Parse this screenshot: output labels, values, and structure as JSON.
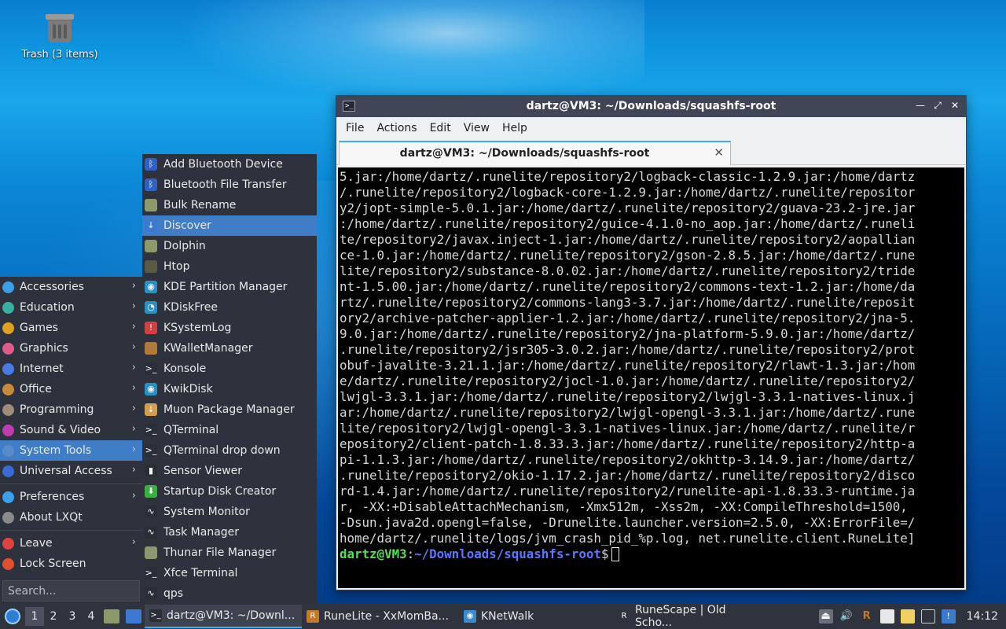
{
  "desktop": {
    "trash_label": "Trash (3 items)"
  },
  "terminal": {
    "window_title": "dartz@VM3: ~/Downloads/squashfs-root",
    "menu": [
      "File",
      "Actions",
      "Edit",
      "View",
      "Help"
    ],
    "tab_title": "dartz@VM3: ~/Downloads/squashfs-root",
    "lines": [
      "5.jar:/home/dartz/.runelite/repository2/logback-classic-1.2.9.jar:/home/dartz",
      "/.runelite/repository2/logback-core-1.2.9.jar:/home/dartz/.runelite/repositor",
      "y2/jopt-simple-5.0.1.jar:/home/dartz/.runelite/repository2/guava-23.2-jre.jar",
      ":/home/dartz/.runelite/repository2/guice-4.1.0-no_aop.jar:/home/dartz/.runeli",
      "te/repository2/javax.inject-1.jar:/home/dartz/.runelite/repository2/aopallian",
      "ce-1.0.jar:/home/dartz/.runelite/repository2/gson-2.8.5.jar:/home/dartz/.rune",
      "lite/repository2/substance-8.0.02.jar:/home/dartz/.runelite/repository2/tride",
      "nt-1.5.00.jar:/home/dartz/.runelite/repository2/commons-text-1.2.jar:/home/da",
      "rtz/.runelite/repository2/commons-lang3-3.7.jar:/home/dartz/.runelite/reposit",
      "ory2/archive-patcher-applier-1.2.jar:/home/dartz/.runelite/repository2/jna-5.",
      "9.0.jar:/home/dartz/.runelite/repository2/jna-platform-5.9.0.jar:/home/dartz/",
      ".runelite/repository2/jsr305-3.0.2.jar:/home/dartz/.runelite/repository2/prot",
      "obuf-javalite-3.21.1.jar:/home/dartz/.runelite/repository2/rlawt-1.3.jar:/hom",
      "e/dartz/.runelite/repository2/jocl-1.0.jar:/home/dartz/.runelite/repository2/",
      "lwjgl-3.3.1.jar:/home/dartz/.runelite/repository2/lwjgl-3.3.1-natives-linux.j",
      "ar:/home/dartz/.runelite/repository2/lwjgl-opengl-3.3.1.jar:/home/dartz/.rune",
      "lite/repository2/lwjgl-opengl-3.3.1-natives-linux.jar:/home/dartz/.runelite/r",
      "epository2/client-patch-1.8.33.3.jar:/home/dartz/.runelite/repository2/http-a",
      "pi-1.1.3.jar:/home/dartz/.runelite/repository2/okhttp-3.14.9.jar:/home/dartz/",
      ".runelite/repository2/okio-1.17.2.jar:/home/dartz/.runelite/repository2/disco",
      "rd-1.4.jar:/home/dartz/.runelite/repository2/runelite-api-1.8.33.3-runtime.ja",
      "r, -XX:+DisableAttachMechanism, -Xmx512m, -Xss2m, -XX:CompileThreshold=1500,",
      "-Dsun.java2d.opengl=false, -Drunelite.launcher.version=2.5.0, -XX:ErrorFile=/",
      "home/dartz/.runelite/logs/jvm_crash_pid_%p.log, net.runelite.client.RuneLite]"
    ],
    "prompt_user": "dartz@VM3",
    "prompt_sep": ":",
    "prompt_path": "~/Downloads/squashfs-root",
    "prompt_end": "$"
  },
  "start_menu": {
    "categories": [
      {
        "label": "Accessories",
        "icon_color": "#3aa0e8"
      },
      {
        "label": "Education",
        "icon_color": "#38b0a0"
      },
      {
        "label": "Games",
        "icon_color": "#e0a020"
      },
      {
        "label": "Graphics",
        "icon_color": "#e05a8a"
      },
      {
        "label": "Internet",
        "icon_color": "#4a7ae8"
      },
      {
        "label": "Office",
        "icon_color": "#c88a3a"
      },
      {
        "label": "Programming",
        "icon_color": "#a08a7a"
      },
      {
        "label": "Sound & Video",
        "icon_color": "#c03ab0"
      },
      {
        "label": "System Tools",
        "icon_color": "#5a8ac8"
      },
      {
        "label": "Universal Access",
        "icon_color": "#3a6ad8"
      }
    ],
    "extras": [
      {
        "label": "Preferences",
        "icon_color": "#3aa0e8"
      },
      {
        "label": "About LXQt",
        "icon_color": "#8a8a8a"
      }
    ],
    "session": [
      {
        "label": "Leave",
        "icon_color": "#e04040"
      },
      {
        "label": "Lock Screen",
        "icon_color": "#e05030"
      }
    ],
    "search_placeholder": "Search..."
  },
  "system_tools": [
    {
      "label": "Add Bluetooth Device",
      "icon": "bluetooth-icon",
      "color": "#3060c0",
      "glyph": "ᛒ"
    },
    {
      "label": "Bluetooth File Transfer",
      "icon": "bluetooth-icon",
      "color": "#3060c0",
      "glyph": "ᛒ"
    },
    {
      "label": "Bulk Rename",
      "icon": "folder-rename-icon",
      "color": "#8a9a6a",
      "glyph": ""
    },
    {
      "label": "Discover",
      "icon": "download-icon",
      "color": "#3a7ad0",
      "glyph": "↓"
    },
    {
      "label": "Dolphin",
      "icon": "folder-icon",
      "color": "#8a9a6a",
      "glyph": ""
    },
    {
      "label": "Htop",
      "icon": "htop-icon",
      "color": "#5a5a48",
      "glyph": ""
    },
    {
      "label": "KDE Partition Manager",
      "icon": "disk-icon",
      "color": "#2a90c0",
      "glyph": "◉"
    },
    {
      "label": "KDiskFree",
      "icon": "disk-free-icon",
      "color": "#2a90c0",
      "glyph": "◔"
    },
    {
      "label": "KSystemLog",
      "icon": "log-icon",
      "color": "#d04040",
      "glyph": "!"
    },
    {
      "label": "KWalletManager",
      "icon": "wallet-icon",
      "color": "#b07a3a",
      "glyph": ""
    },
    {
      "label": "Konsole",
      "icon": "terminal-icon",
      "color": "#2a2e36",
      "glyph": ">_"
    },
    {
      "label": "KwikDisk",
      "icon": "kwikdisk-icon",
      "color": "#2a90c0",
      "glyph": "◉"
    },
    {
      "label": "Muon Package Manager",
      "icon": "package-icon",
      "color": "#d0a050",
      "glyph": "↓"
    },
    {
      "label": "QTerminal",
      "icon": "terminal-icon",
      "color": "#2a2e36",
      "glyph": ">_"
    },
    {
      "label": "QTerminal drop down",
      "icon": "terminal-icon",
      "color": "#2a2e36",
      "glyph": ">_"
    },
    {
      "label": "Sensor Viewer",
      "icon": "sensor-icon",
      "color": "#2a2e36",
      "glyph": "▮"
    },
    {
      "label": "Startup Disk Creator",
      "icon": "usb-icon",
      "color": "#3ab040",
      "glyph": "⬇"
    },
    {
      "label": "System Monitor",
      "icon": "monitor-icon",
      "color": "#2a2e36",
      "glyph": "∿"
    },
    {
      "label": "Task Manager",
      "icon": "task-manager-icon",
      "color": "#2a2e36",
      "glyph": "∿"
    },
    {
      "label": "Thunar File Manager",
      "icon": "folder-icon",
      "color": "#8a9a6a",
      "glyph": ""
    },
    {
      "label": "Xfce Terminal",
      "icon": "terminal-icon",
      "color": "#2a2e36",
      "glyph": ">_"
    },
    {
      "label": "qps",
      "icon": "qps-icon",
      "color": "#2a2e36",
      "glyph": "∿"
    }
  ],
  "taskbar": {
    "desktops": [
      "1",
      "2",
      "3",
      "4"
    ],
    "tasks": [
      {
        "label": "dartz@VM3: ~/Downl...",
        "icon": "terminal-icon",
        "color": "#2a2e36",
        "glyph": ">_"
      },
      {
        "label": "RuneLite - XxMomBa...",
        "icon": "runelite-icon",
        "color": "#c07a2a",
        "glyph": "R"
      },
      {
        "label": "KNetWalk",
        "icon": "knetwalk-icon",
        "color": "#3a8ad0",
        "glyph": "◉"
      },
      {
        "label": "RuneScape | Old Scho...",
        "icon": "runescape-icon",
        "color": "#2e333d",
        "glyph": "R"
      }
    ],
    "clock": "14:12"
  }
}
